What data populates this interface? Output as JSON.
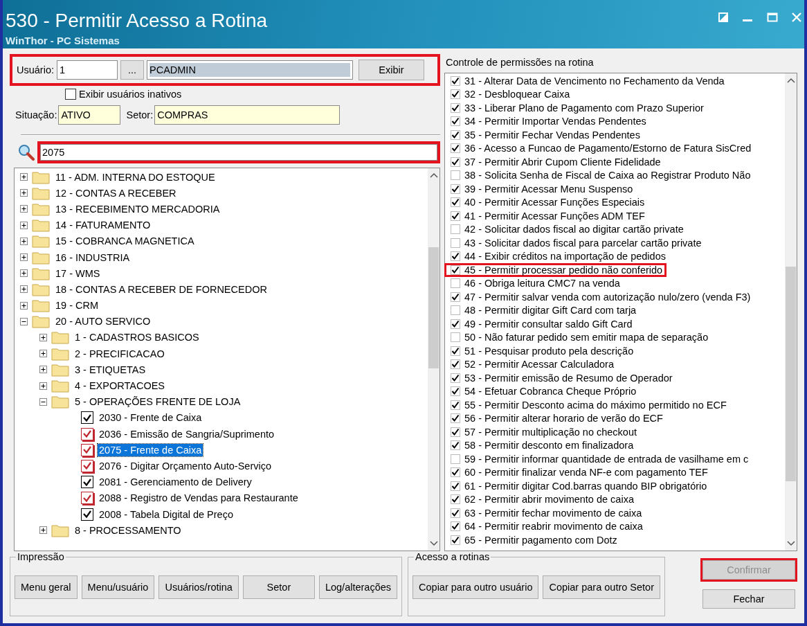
{
  "window": {
    "title": "530 - Permitir Acesso a Rotina",
    "subtitle": "WinThor - PC Sistemas"
  },
  "user": {
    "label": "Usuário:",
    "id": "1",
    "lookup": "...",
    "name": "PCADMIN",
    "button": "Exibir",
    "highlighted": true
  },
  "inactive": {
    "label": "Exibir usuários inativos",
    "checked": false
  },
  "situacao": {
    "label": "Situação:",
    "value": "ATIVO"
  },
  "setor": {
    "label": "Setor:",
    "value": "COMPRAS"
  },
  "search": {
    "value": "2075",
    "highlighted": true
  },
  "tree": [
    {
      "kind": "folder",
      "label": "11 - ADM. INTERNA DO ESTOQUE",
      "expanded": false
    },
    {
      "kind": "folder",
      "label": "12 - CONTAS A RECEBER",
      "expanded": false
    },
    {
      "kind": "folder",
      "label": "13 - RECEBIMENTO MERCADORIA",
      "expanded": false
    },
    {
      "kind": "folder",
      "label": "14 - FATURAMENTO",
      "expanded": false
    },
    {
      "kind": "folder",
      "label": "15 - COBRANCA MAGNETICA",
      "expanded": false
    },
    {
      "kind": "folder",
      "label": "16 - INDUSTRIA",
      "expanded": false
    },
    {
      "kind": "folder",
      "label": "17 - WMS",
      "expanded": false
    },
    {
      "kind": "folder",
      "label": "18 - CONTAS A RECEBER DE FORNECEDOR",
      "expanded": false
    },
    {
      "kind": "folder",
      "label": "19 - CRM",
      "expanded": false
    },
    {
      "kind": "folder",
      "label": "20 - AUTO SERVICO",
      "expanded": true,
      "children": [
        {
          "kind": "folder",
          "label": "1 - CADASTROS BASICOS",
          "expanded": false
        },
        {
          "kind": "folder",
          "label": "2 - PRECIFICACAO",
          "expanded": false
        },
        {
          "kind": "folder",
          "label": "3 - ETIQUETAS",
          "expanded": false
        },
        {
          "kind": "folder",
          "label": "4 - EXPORTACOES",
          "expanded": false
        },
        {
          "kind": "folder",
          "label": "5 - OPERAÇÕES FRENTE DE LOJA",
          "expanded": true,
          "children": [
            {
              "kind": "routine",
              "label": "2030 - Frente de Caixa",
              "checked": true,
              "color": "#000000",
              "selected": false
            },
            {
              "kind": "routine",
              "label": "2036 - Emissão de Sangria/Suprimento",
              "checked": true,
              "color": "#c0262d",
              "selected": false
            },
            {
              "kind": "routine",
              "label": "2075 - Frente de Caixa",
              "checked": true,
              "color": "#c0262d",
              "selected": true
            },
            {
              "kind": "routine",
              "label": "2076 - Digitar Orçamento Auto-Serviço",
              "checked": true,
              "color": "#c0262d",
              "selected": false
            },
            {
              "kind": "routine",
              "label": "2081 - Gerenciamento de Delivery",
              "checked": true,
              "color": "#000000",
              "selected": false
            },
            {
              "kind": "routine",
              "label": "2088 - Registro de Vendas para Restaurante",
              "checked": true,
              "color": "#c0262d",
              "selected": false
            },
            {
              "kind": "routine",
              "label": "2008 - Tabela Digital de Preço",
              "checked": true,
              "color": "#000000",
              "selected": false
            }
          ]
        },
        {
          "kind": "folder",
          "label": "8 - PROCESSAMENTO",
          "expanded": false
        }
      ]
    }
  ],
  "permissions": {
    "title": "Controle de permissões na rotina",
    "items": [
      {
        "label": "31 - Alterar Data de Vencimento no Fechamento da Venda",
        "checked": true,
        "highlighted": false
      },
      {
        "label": "32 - Desbloquear Caixa",
        "checked": true,
        "highlighted": false
      },
      {
        "label": "33 - Liberar Plano de Pagamento com Prazo Superior",
        "checked": true,
        "highlighted": false
      },
      {
        "label": "34 - Permitir Importar Vendas Pendentes",
        "checked": true,
        "highlighted": false
      },
      {
        "label": "35 - Permitir Fechar Vendas Pendentes",
        "checked": true,
        "highlighted": false
      },
      {
        "label": "36 - Acesso a Funcao de Pagamento/Estorno de Fatura SisCred",
        "checked": true,
        "highlighted": false
      },
      {
        "label": "37 - Permitir Abrir Cupom Cliente Fidelidade",
        "checked": true,
        "highlighted": false
      },
      {
        "label": "38 - Solicita Senha de Fiscal de Caixa ao Registrar Produto Não",
        "checked": false,
        "highlighted": false
      },
      {
        "label": "39 - Permitir Acessar Menu Suspenso",
        "checked": true,
        "highlighted": false
      },
      {
        "label": "40 - Permitir Acessar Funções Especiais",
        "checked": true,
        "highlighted": false
      },
      {
        "label": "41 - Permitir Acessar Funções ADM TEF",
        "checked": true,
        "highlighted": false
      },
      {
        "label": "42 - Solicitar dados fiscal ao digitar cartão private",
        "checked": false,
        "highlighted": false
      },
      {
        "label": "43 - Solicitar dados fiscal para parcelar cartão private",
        "checked": false,
        "highlighted": false
      },
      {
        "label": "44 - Exibir créditos na importação de pedidos",
        "checked": true,
        "highlighted": false
      },
      {
        "label": "45 - Permitir processar pedido não conferido",
        "checked": true,
        "highlighted": true
      },
      {
        "label": "46 - Obriga leitura CMC7 na venda",
        "checked": false,
        "highlighted": false
      },
      {
        "label": "47 - Permitir salvar venda com autorização nulo/zero (venda F3)",
        "checked": true,
        "highlighted": false
      },
      {
        "label": "48 - Permitir digitar Gift Card com tarja",
        "checked": false,
        "highlighted": false
      },
      {
        "label": "49 - Permitir consultar saldo Gift Card",
        "checked": true,
        "highlighted": false
      },
      {
        "label": "50 - Não faturar pedido sem emitir mapa de separação",
        "checked": false,
        "highlighted": false
      },
      {
        "label": "51 - Pesquisar produto pela descrição",
        "checked": true,
        "highlighted": false
      },
      {
        "label": "52 - Permitir Acessar Calculadora",
        "checked": true,
        "highlighted": false
      },
      {
        "label": "53 - Permitir emissão de Resumo de Operador",
        "checked": true,
        "highlighted": false
      },
      {
        "label": "54 - Efetuar Cobranca Cheque Próprio",
        "checked": true,
        "highlighted": false
      },
      {
        "label": "55 - Permitir Desconto acima do máximo permitido no ECF",
        "checked": true,
        "highlighted": false
      },
      {
        "label": "56 - Permitir alterar horario de verão do ECF",
        "checked": true,
        "highlighted": false
      },
      {
        "label": "57 - Permitir multiplicação no checkout",
        "checked": true,
        "highlighted": false
      },
      {
        "label": "58 - Permitir desconto em finalizadora",
        "checked": true,
        "highlighted": false
      },
      {
        "label": "59 - Permitir informar quantidade de entrada de vasilhame em c",
        "checked": false,
        "highlighted": false
      },
      {
        "label": "60 - Permitir finalizar venda NF-e com pagamento TEF",
        "checked": true,
        "highlighted": false
      },
      {
        "label": "61 - Permitir digitar Cod.barras quando BIP obrigatório",
        "checked": true,
        "highlighted": false
      },
      {
        "label": "62 - Permitir abrir movimento de caixa",
        "checked": true,
        "highlighted": false
      },
      {
        "label": "63 - Permitir fechar movimento de caixa",
        "checked": true,
        "highlighted": false
      },
      {
        "label": "64 - Permitir reabrir movimento de caixa",
        "checked": true,
        "highlighted": false
      },
      {
        "label": "65 - Permitir pagamento com Dotz",
        "checked": true,
        "highlighted": false
      }
    ]
  },
  "impressao": {
    "title": "Impressão",
    "buttons": [
      "Menu geral",
      "Menu/usuário",
      "Usuários/rotina",
      "Setor",
      "Log/alterações"
    ]
  },
  "acesso": {
    "title": "Acesso a rotinas",
    "buttons": [
      "Copiar para outro usuário",
      "Copiar para outro Setor"
    ]
  },
  "actions": [
    {
      "label": "Confirmar",
      "disabled": true,
      "highlighted": true
    },
    {
      "label": "Fechar",
      "disabled": false,
      "highlighted": false
    }
  ]
}
